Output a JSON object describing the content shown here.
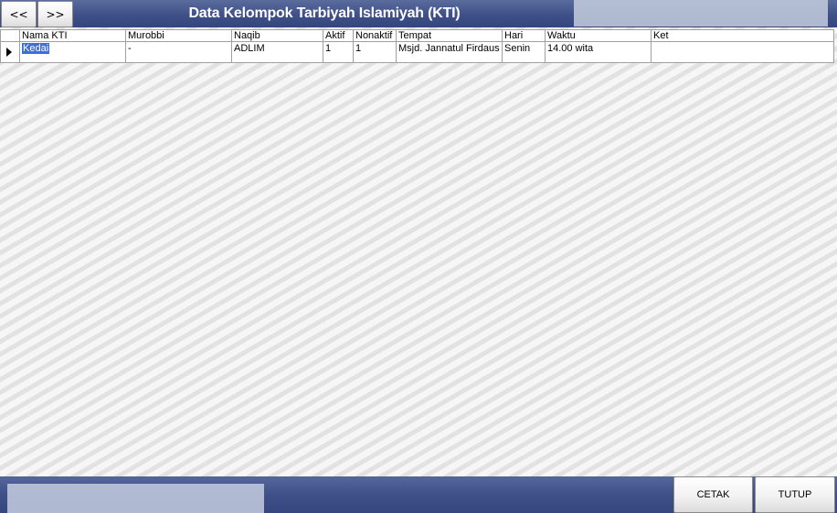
{
  "header": {
    "title": "Data Kelompok Tarbiyah Islamiyah (KTI)",
    "prev_label": "<<",
    "next_label": ">>"
  },
  "grid": {
    "columns": [
      "Nama KTI",
      "Murobbi",
      "Naqib",
      "Aktif",
      "Nonaktif",
      "Tempat",
      "Hari",
      "Waktu",
      "Ket"
    ],
    "rows": [
      {
        "nama_kti": "Kedai",
        "murobbi": "-",
        "naqib": "ADLIM",
        "aktif": "1",
        "nonaktif": "1",
        "tempat": "Msjd. Jannatul Firdaus",
        "hari": "Senin",
        "waktu": "14.00 wita",
        "ket": ""
      }
    ],
    "current_row_icon": "row-pointer-icon"
  },
  "footer": {
    "cetak_label": "CETAK",
    "tutup_label": "TUTUP"
  },
  "colors": {
    "header_band": "#3f5089",
    "selection": "#3d6fd8"
  }
}
